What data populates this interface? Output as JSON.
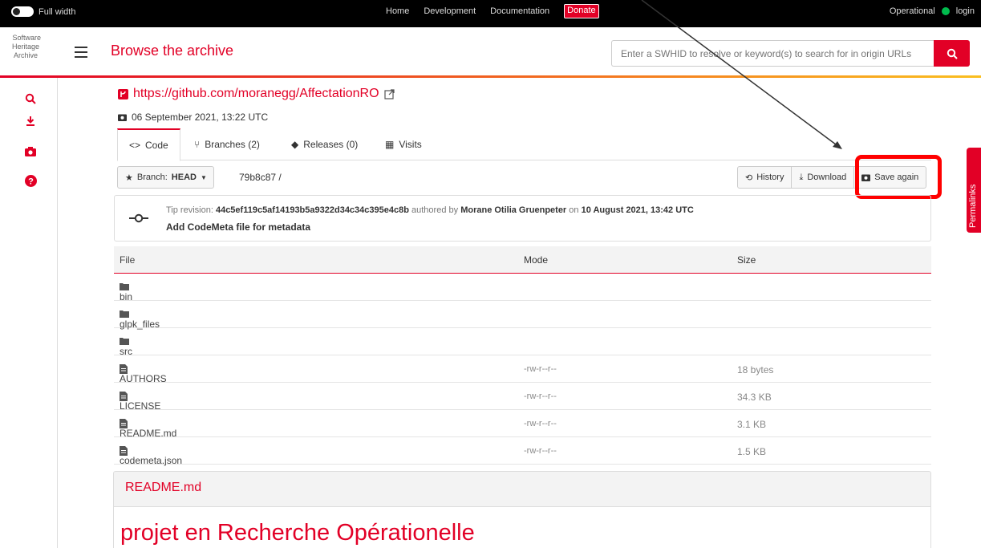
{
  "topbar": {
    "full_width": "Full width",
    "nav": [
      "Home",
      "Development",
      "Documentation"
    ],
    "donate": "Donate",
    "status": "Operational",
    "login": "login",
    "status_color": "#00bb4d"
  },
  "header": {
    "logo_text": "Software Heritage Archive",
    "title": "Browse the archive",
    "search_placeholder": "Enter a SWHID to resolve or keyword(s) to search for in origin URLs"
  },
  "origin": {
    "url": "https://github.com/moranegg/AffectationRO",
    "visit_date": "06 September 2021, 13:22 UTC"
  },
  "tabs": [
    {
      "label": "Code",
      "icon": "code-icon"
    },
    {
      "label": "Branches (2)",
      "icon": "branch-icon"
    },
    {
      "label": "Releases (0)",
      "icon": "tag-icon"
    },
    {
      "label": "Visits",
      "icon": "calendar-icon"
    }
  ],
  "branch": {
    "prefix": "Branch:",
    "name": "HEAD",
    "path": "79b8c87 /"
  },
  "actions": {
    "history": "History",
    "download": "Download",
    "save_again": "Save again"
  },
  "revision": {
    "prefix": "Tip revision:",
    "hash": "44c5ef119c5af14193b5a9322d34c34c395e4c8b",
    "authored_by": "authored by",
    "author": "Morane Otilia Gruenpeter",
    "on": "on",
    "date": "10 August 2021, 13:42 UTC",
    "message": "Add CodeMeta file for metadata"
  },
  "table": {
    "headers": {
      "file": "File",
      "mode": "Mode",
      "size": "Size"
    },
    "rows": [
      {
        "name": "bin",
        "type": "folder",
        "mode": "",
        "size": ""
      },
      {
        "name": "glpk_files",
        "type": "folder",
        "mode": "",
        "size": ""
      },
      {
        "name": "src",
        "type": "folder",
        "mode": "",
        "size": ""
      },
      {
        "name": "AUTHORS",
        "type": "file",
        "mode": "-rw-r--r--",
        "size": "18 bytes"
      },
      {
        "name": "LICENSE",
        "type": "file",
        "mode": "-rw-r--r--",
        "size": "34.3 KB"
      },
      {
        "name": "README.md",
        "type": "file",
        "mode": "-rw-r--r--",
        "size": "3.1 KB"
      },
      {
        "name": "codemeta.json",
        "type": "file",
        "mode": "-rw-r--r--",
        "size": "1.5 KB"
      }
    ]
  },
  "readme": {
    "title": "README.md",
    "heading": "projet en Recherche Opérationelle"
  },
  "permalinks": "Permalinks",
  "colors": {
    "accent": "#e20026",
    "annotation": "#ff0000"
  }
}
